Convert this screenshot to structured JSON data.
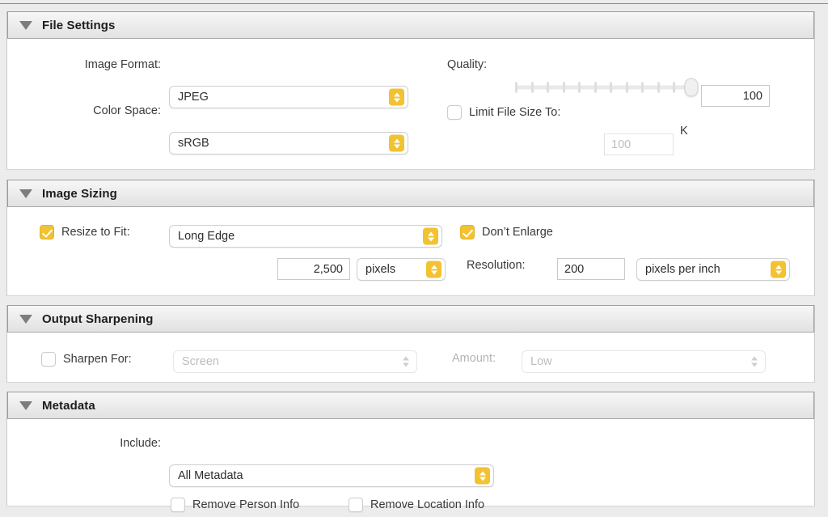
{
  "accent_color": "#F2C230",
  "sections": {
    "file_settings": {
      "title": "File Settings",
      "image_format_label": "Image Format:",
      "image_format_value": "JPEG",
      "color_space_label": "Color Space:",
      "color_space_value": "sRGB",
      "quality_label": "Quality:",
      "quality_value": "100",
      "quality_slider": {
        "min": 0,
        "max": 100,
        "value": 100,
        "tick_count": 12
      },
      "limit_file_size_label": "Limit File Size To:",
      "limit_file_size_checked": false,
      "limit_file_size_placeholder": "100",
      "limit_file_size_unit": "K"
    },
    "image_sizing": {
      "title": "Image Sizing",
      "resize_to_fit_label": "Resize to Fit:",
      "resize_to_fit_checked": true,
      "resize_mode_value": "Long Edge",
      "dont_enlarge_label": "Don’t Enlarge",
      "dont_enlarge_checked": true,
      "size_value": "2,500",
      "size_unit_value": "pixels",
      "resolution_label": "Resolution:",
      "resolution_value": "200",
      "resolution_unit_value": "pixels per inch"
    },
    "output_sharpening": {
      "title": "Output Sharpening",
      "sharpen_for_label": "Sharpen For:",
      "sharpen_for_checked": false,
      "sharpen_for_value": "Screen",
      "amount_label": "Amount:",
      "amount_value": "Low",
      "disabled": true
    },
    "metadata": {
      "title": "Metadata",
      "include_label": "Include:",
      "include_value": "All Metadata",
      "remove_person_info_label": "Remove Person Info",
      "remove_person_info_checked": false,
      "remove_location_info_label": "Remove Location Info",
      "remove_location_info_checked": false
    }
  }
}
